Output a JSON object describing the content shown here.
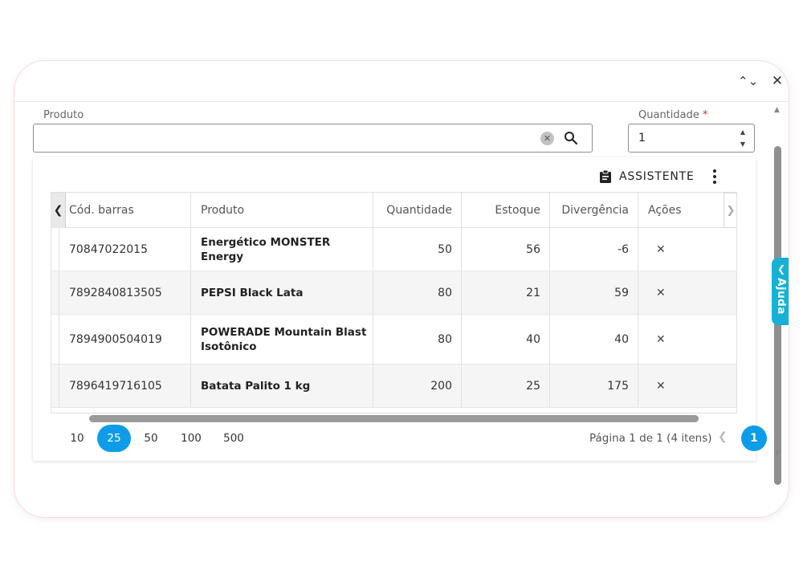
{
  "form": {
    "produto_label": "Produto",
    "produto_value": "",
    "quantidade_label": "Quantidade",
    "quantidade_required": "*",
    "quantidade_value": "1"
  },
  "toolbar": {
    "assist_label": "ASSISTENTE"
  },
  "table": {
    "columns": [
      "Cód. barras",
      "Produto",
      "Quantidade",
      "Estoque",
      "Divergência",
      "Ações"
    ],
    "rows": [
      {
        "cod": "70847022015",
        "produto": "Energético MONSTER Energy",
        "quantidade": "50",
        "estoque": "56",
        "divergencia": "-6",
        "acao": "✕"
      },
      {
        "cod": "7892840813505",
        "produto": "PEPSI Black Lata",
        "quantidade": "80",
        "estoque": "21",
        "divergencia": "59",
        "acao": "✕"
      },
      {
        "cod": "7894900504019",
        "produto": "POWERADE Mountain Blast Isotônico",
        "quantidade": "80",
        "estoque": "40",
        "divergencia": "40",
        "acao": "✕"
      },
      {
        "cod": "7896419716105",
        "produto": "Batata Palito 1 kg",
        "quantidade": "200",
        "estoque": "25",
        "divergencia": "175",
        "acao": "✕"
      }
    ]
  },
  "pager": {
    "sizes": [
      "10",
      "25",
      "50",
      "100",
      "500"
    ],
    "active_size": "25",
    "info": "Página 1 de 1 (4 itens)",
    "current_page": "1"
  },
  "help": {
    "label": "Ajuda"
  },
  "colors": {
    "accent": "#0e9ce8",
    "help_tab": "#15b2d6"
  },
  "icons": {
    "collapse": "collapse-icon",
    "close": "close-icon",
    "clear": "clear-icon",
    "search": "search-icon",
    "assistant": "clipboard-icon",
    "more": "more-vert-icon",
    "delete": "close-icon"
  }
}
